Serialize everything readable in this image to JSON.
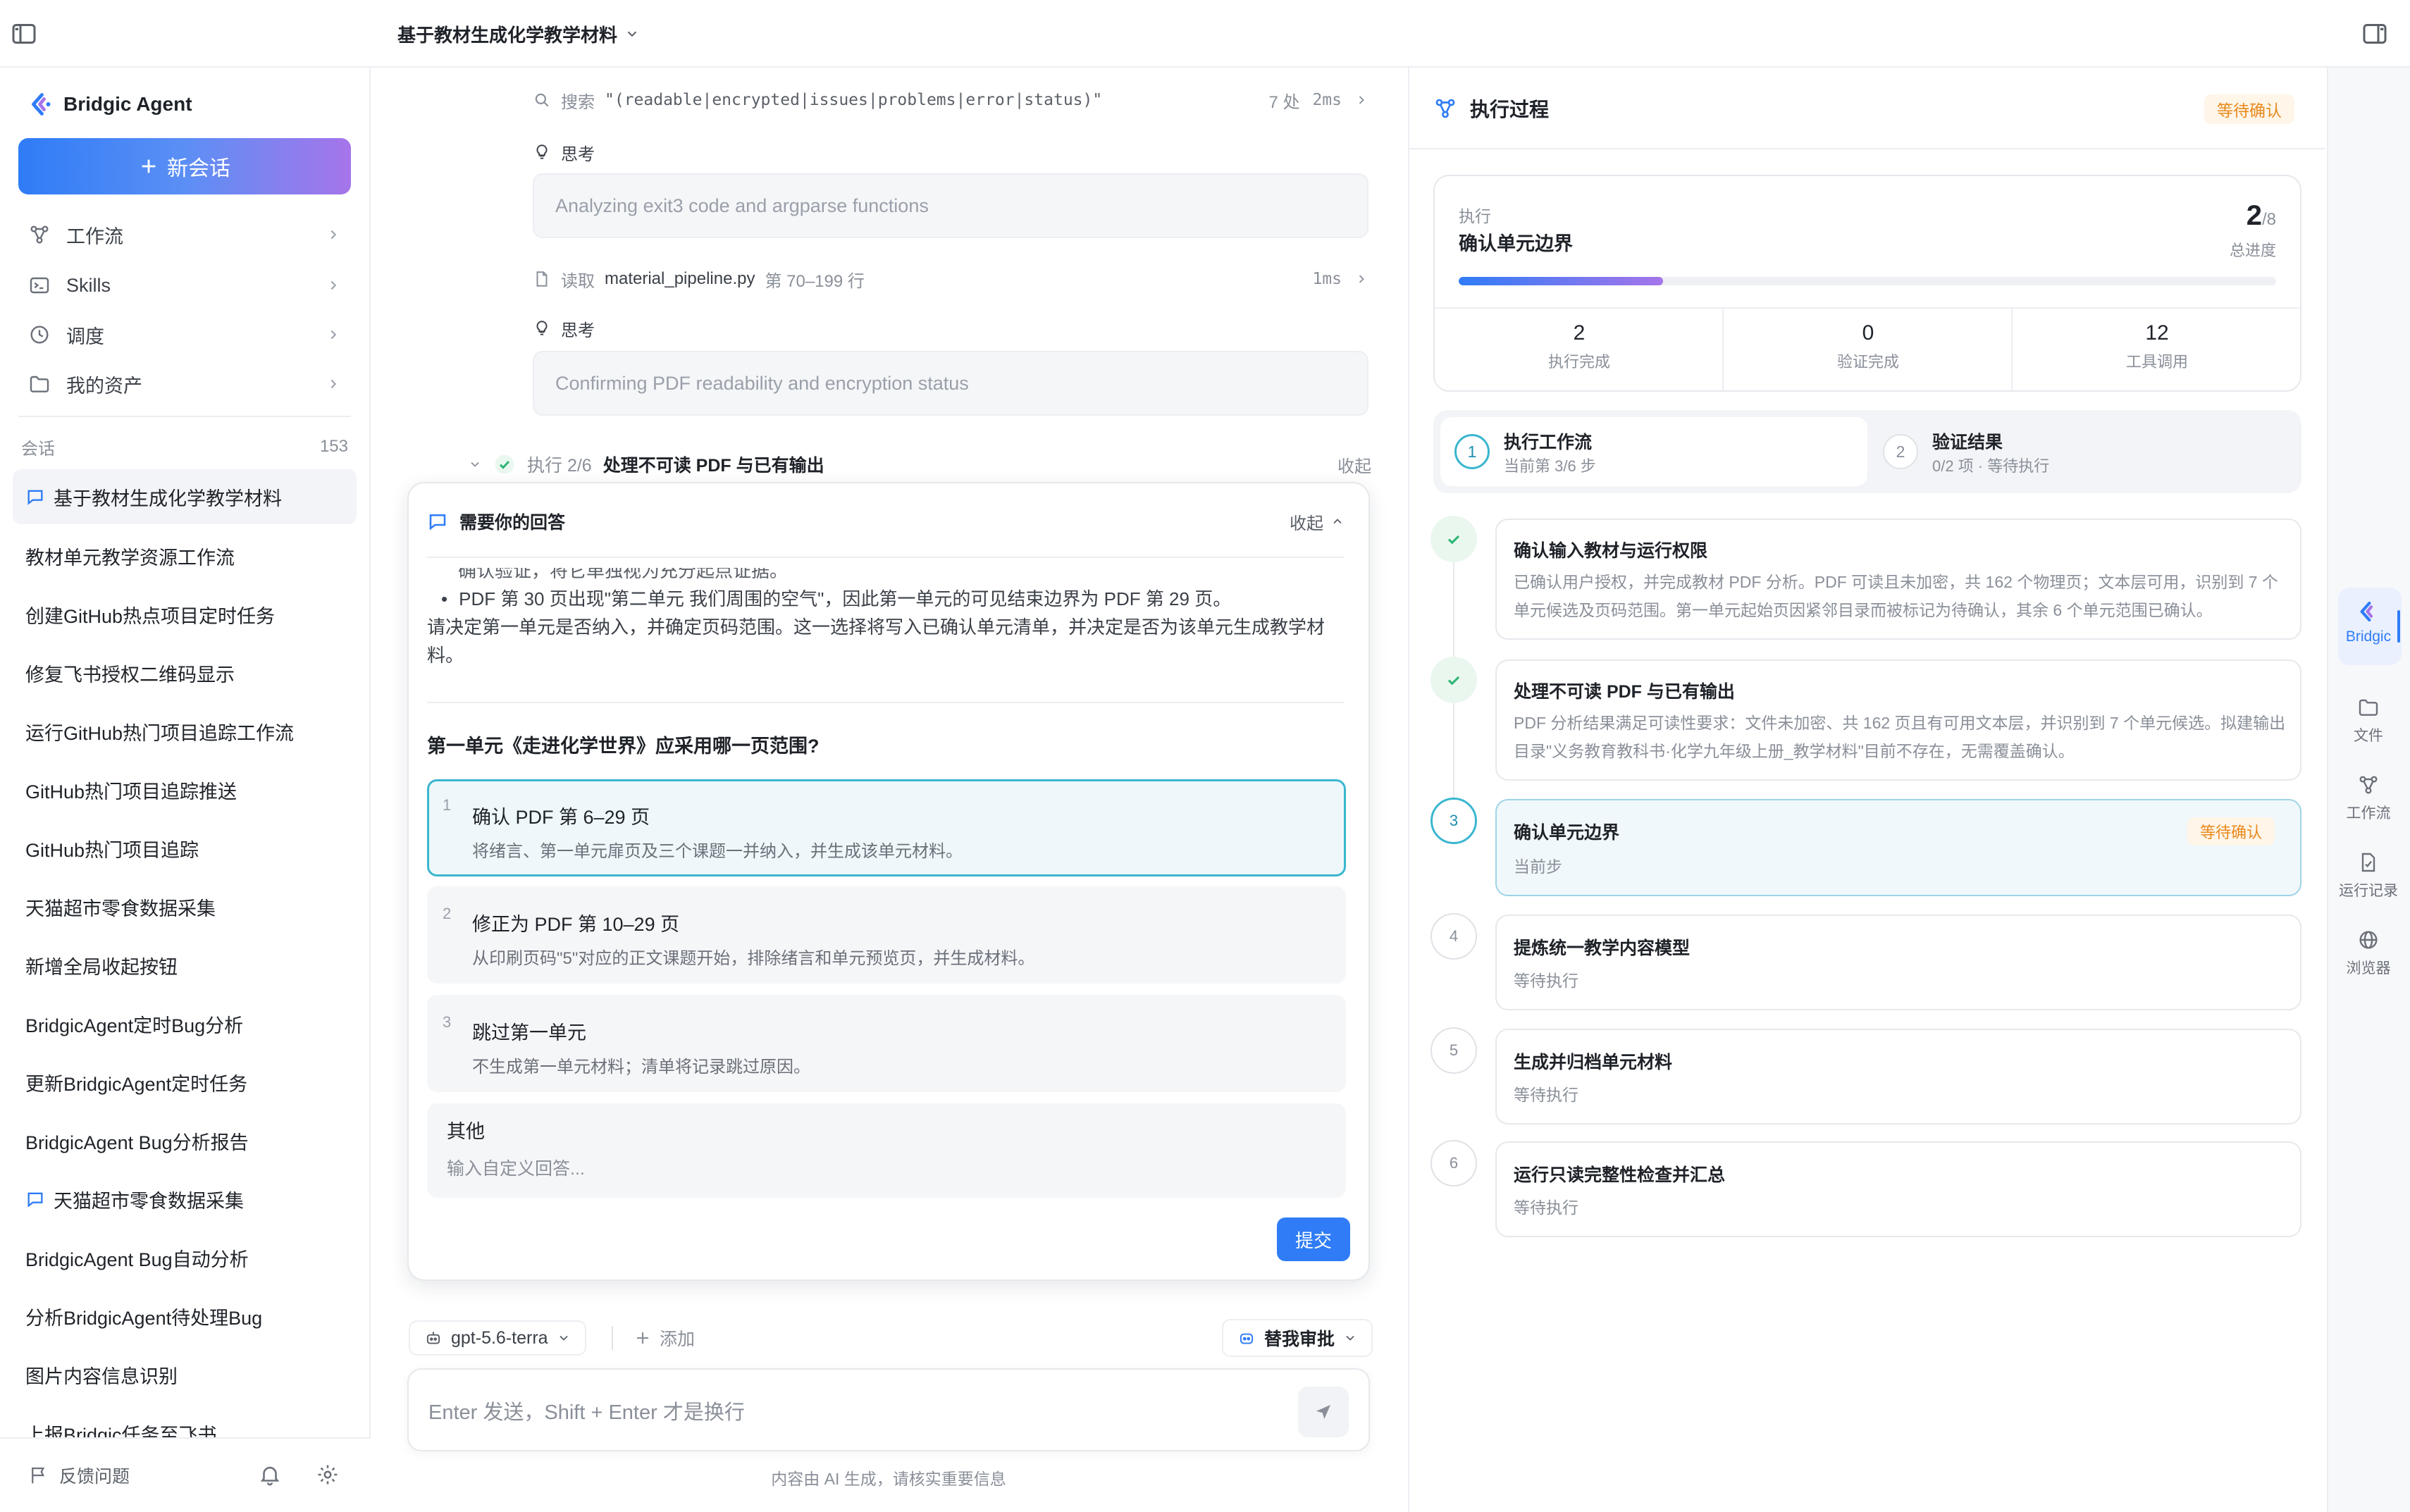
{
  "header": {
    "title": "基于教材生成化学教学材料"
  },
  "sidebar": {
    "brand": "Bridgic Agent",
    "new_chat": "新会话",
    "nav": [
      {
        "label": "工作流",
        "icon": "workflow-icon"
      },
      {
        "label": "Skills",
        "icon": "terminal-icon"
      },
      {
        "label": "调度",
        "icon": "clock-icon"
      },
      {
        "label": "我的资产",
        "icon": "folder-icon"
      }
    ],
    "sessions_label": "会话",
    "sessions_count": "153",
    "sessions": [
      "基于教材生成化学教学材料",
      "教材单元教学资源工作流",
      "创建GitHub热点项目定时任务",
      "修复飞书授权二维码显示",
      "运行GitHub热门项目追踪工作流",
      "GitHub热门项目追踪推送",
      "GitHub热门项目追踪",
      "天猫超市零食数据采集",
      "新增全局收起按钮",
      "BridgicAgent定时Bug分析",
      "更新BridgicAgent定时任务",
      "BridgicAgent Bug分析报告",
      "天猫超市零食数据采集",
      "BridgicAgent Bug自动分析",
      "分析BridgicAgent待处理Bug",
      "图片内容信息识别",
      "上报Bridgic任务至飞书"
    ],
    "feedback": "反馈问题"
  },
  "chat": {
    "search_row": {
      "verb": "搜索",
      "query": "\"(readable|encrypted|issues|problems|error|status)\"",
      "count": "7 处",
      "time": "2ms"
    },
    "think_label": "思考",
    "think_1": "Analyzing exit3 code and argparse functions",
    "read_row": {
      "verb": "读取",
      "file": "material_pipeline.py",
      "range": "第 70–199 行",
      "time": "1ms"
    },
    "think_2": "Confirming PDF readability and encryption status",
    "step": {
      "progress": "执行 2/6",
      "title": "处理不可读 PDF 与已有输出",
      "collapse": "收起"
    },
    "answer": {
      "title": "需要你的回答",
      "collapse": "收起",
      "cut_line": "确认验证，将它单独视为充分起点证据。",
      "bullet": "PDF 第 30 页出现\"第二单元 我们周围的空气\"，因此第一单元的可见结束边界为 PDF 第 29 页。",
      "paragraph": "请决定第一单元是否纳入，并确定页码范围。这一选择将写入已确认单元清单，并决定是否为该单元生成教学材料。",
      "question": "第一单元《走进化学世界》应采用哪一页范围?",
      "options": [
        {
          "num": "1",
          "title": "确认 PDF 第 6–29 页",
          "desc": "将绪言、第一单元扉页及三个课题一并纳入，并生成该单元材料。"
        },
        {
          "num": "2",
          "title": "修正为 PDF 第 10–29 页",
          "desc": "从印刷页码\"5\"对应的正文课题开始，排除绪言和单元预览页，并生成材料。"
        },
        {
          "num": "3",
          "title": "跳过第一单元",
          "desc": "不生成第一单元材料；清单将记录跳过原因。"
        }
      ],
      "other_label": "其他",
      "other_placeholder": "输入自定义回答...",
      "submit": "提交"
    },
    "composer": {
      "model": "gpt-5.6-terra",
      "add": "添加",
      "approve": "替我审批",
      "placeholder": "Enter 发送，Shift + Enter 才是换行",
      "disclaimer": "内容由 AI 生成，请核实重要信息"
    }
  },
  "panel": {
    "title": "执行过程",
    "badge": "等待确认",
    "progress": {
      "label": "执行",
      "current": "确认单元边界",
      "done": "2",
      "total": "/8",
      "fraction": 0.25,
      "total_label": "总进度",
      "stats": [
        {
          "value": "2",
          "label": "执行完成"
        },
        {
          "value": "0",
          "label": "验证完成"
        },
        {
          "value": "12",
          "label": "工具调用"
        }
      ]
    },
    "phases": [
      {
        "num": "1",
        "title": "执行工作流",
        "sub": "当前第 3/6 步"
      },
      {
        "num": "2",
        "title": "验证结果",
        "sub": "0/2 项 · 等待执行"
      }
    ],
    "steps": [
      {
        "num": "1",
        "title": "确认输入教材与运行权限",
        "desc": "已确认用户授权，并完成教材 PDF 分析。PDF 可读且未加密，共 162 个物理页；文本层可用，识别到 7 个单元候选及页码范围。第一单元起始页因紧邻目录而被标记为待确认，其余 6 个单元范围已确认。"
      },
      {
        "num": "2",
        "title": "处理不可读 PDF 与已有输出",
        "desc": "PDF 分析结果满足可读性要求：文件未加密、共 162 页且有可用文本层，并识别到 7 个单元候选。拟建输出目录\"义务教育教科书·化学九年级上册_教学材料\"目前不存在，无需覆盖确认。"
      },
      {
        "num": "3",
        "title": "确认单元边界",
        "desc": "当前步",
        "badge": "等待确认"
      },
      {
        "num": "4",
        "title": "提炼统一教学内容模型",
        "desc": "等待执行"
      },
      {
        "num": "5",
        "title": "生成并归档单元材料",
        "desc": "等待执行"
      },
      {
        "num": "6",
        "title": "运行只读完整性检查并汇总",
        "desc": "等待执行"
      }
    ]
  },
  "rail": [
    {
      "label": "Bridgic",
      "icon": "bridgic-logo-icon"
    },
    {
      "label": "文件",
      "icon": "folder-icon"
    },
    {
      "label": "工作流",
      "icon": "workflow-icon"
    },
    {
      "label": "运行记录",
      "icon": "log-icon"
    },
    {
      "label": "浏览器",
      "icon": "globe-icon"
    }
  ],
  "colors": {
    "accent": "#2f7cf6",
    "teal": "#3bb6d0",
    "warning": "#e8891c",
    "success": "#2bb673"
  }
}
